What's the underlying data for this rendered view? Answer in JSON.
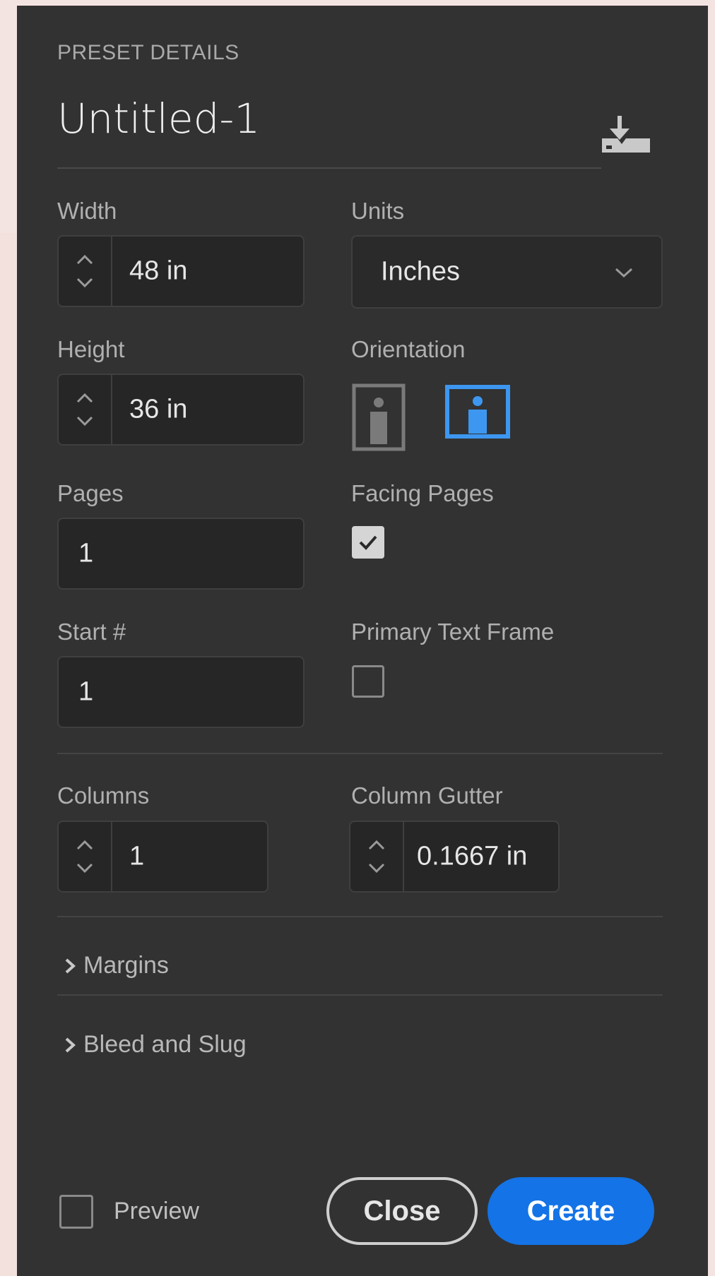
{
  "dialog": {
    "section_title": "PRESET DETAILS",
    "document_name": "Untitled-1",
    "save_preset_icon": "save-preset-icon"
  },
  "width": {
    "label": "Width",
    "value": "48 in"
  },
  "units": {
    "label": "Units",
    "selected": "Inches"
  },
  "height": {
    "label": "Height",
    "value": "36 in"
  },
  "orientation": {
    "label": "Orientation",
    "options": [
      "Portrait",
      "Landscape"
    ],
    "selected": "Landscape",
    "active_color": "#3d97f0"
  },
  "pages": {
    "label": "Pages",
    "value": "1"
  },
  "facing_pages": {
    "label": "Facing Pages",
    "checked": true
  },
  "start_number": {
    "label": "Start #",
    "value": "1"
  },
  "primary_text_frame": {
    "label": "Primary Text Frame",
    "checked": false
  },
  "columns": {
    "label": "Columns",
    "value": "1"
  },
  "column_gutter": {
    "label": "Column Gutter",
    "value": "0.1667 in"
  },
  "margins": {
    "label": "Margins",
    "expanded": false
  },
  "bleed_slug": {
    "label": "Bleed and Slug",
    "expanded": false
  },
  "footer": {
    "preview_label": "Preview",
    "preview_checked": false,
    "close_label": "Close",
    "create_label": "Create",
    "create_color": "#1473e6"
  }
}
